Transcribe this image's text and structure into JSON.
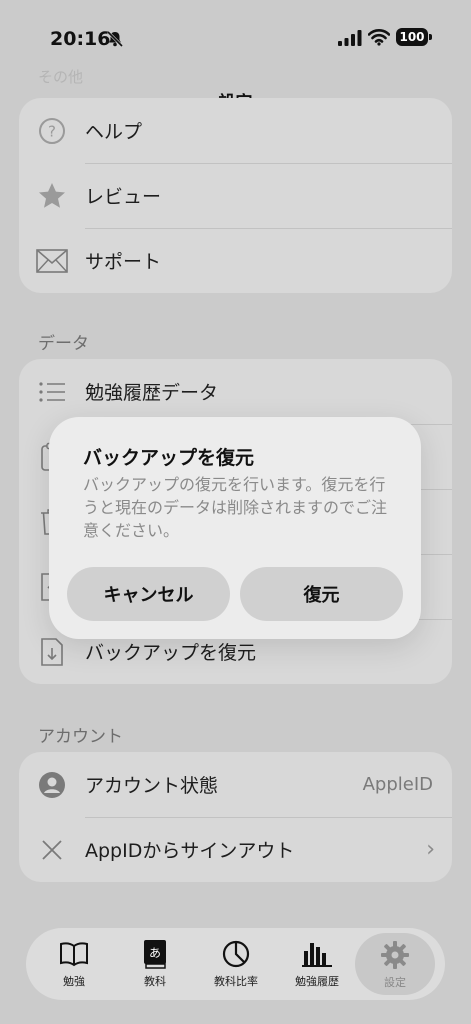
{
  "status": {
    "time": "20:16",
    "battery": "100"
  },
  "nav": {
    "title": "設定",
    "ghost_header": "その他"
  },
  "other_group": {
    "items": [
      {
        "label": "ヘルプ",
        "icon": "question-circle-icon"
      },
      {
        "label": "レビュー",
        "icon": "star-icon"
      },
      {
        "label": "サポート",
        "icon": "envelope-icon"
      }
    ]
  },
  "data_section": {
    "header": "データ",
    "items": [
      {
        "label": "勉強履歴データ",
        "icon": "list-icon"
      },
      {
        "label": "",
        "icon": "clipboard-icon"
      },
      {
        "label": "",
        "icon": "trash-icon"
      },
      {
        "label": "",
        "icon": "document-upload-icon"
      },
      {
        "label": "バックアップを復元",
        "icon": "document-download-icon"
      }
    ]
  },
  "account_section": {
    "header": "アカウント",
    "status_label": "アカウント状態",
    "status_value": "AppleID",
    "signout_label": "AppIDからサインアウト"
  },
  "dialog": {
    "title": "バックアップを復元",
    "message": "バックアップの復元を行います。復元を行うと現在のデータは削除されますのでご注意ください。",
    "cancel_label": "キャンセル",
    "restore_label": "復元"
  },
  "tabs": [
    {
      "label": "勉強",
      "icon": "book-icon"
    },
    {
      "label": "教科",
      "icon": "subject-book-icon"
    },
    {
      "label": "教科比率",
      "icon": "pie-chart-icon"
    },
    {
      "label": "勉強履歴",
      "icon": "bar-chart-icon"
    },
    {
      "label": "設定",
      "icon": "gear-icon",
      "active": true
    }
  ]
}
